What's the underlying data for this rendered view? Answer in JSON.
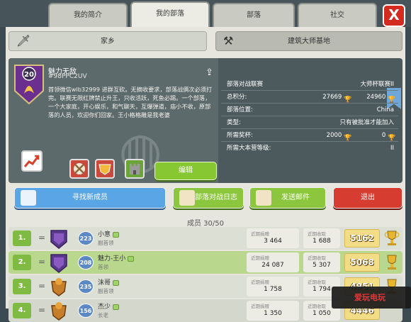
{
  "tabs": [
    {
      "label": "我的简介"
    },
    {
      "label": "我的部落"
    },
    {
      "label": "部落"
    },
    {
      "label": "社交"
    }
  ],
  "close_label": "X",
  "subtabs": {
    "home": "家乡",
    "builder_base": "建筑大师基地"
  },
  "clan": {
    "level": "20",
    "name": "魅力无敌",
    "tag": "#98PPC2UV",
    "description": "首领微信wlb32999 进群互砍。无摘收要求，部落战俩次必须打完。联赛无限红牌禁止升王，只收活跃，死鱼必踢。一个部落，一个大家庭，开心娱乐，和气聊天，互爆弹道，庙小不收，原部落的人员，欢迎你们回家。王小格格雕是我老婆",
    "edit_label": "编辑"
  },
  "stats": [
    {
      "key": "部落对战联赛",
      "value": "大师杯联赛II"
    },
    {
      "key": "总积分:",
      "value": "27669",
      "value2": "24960"
    },
    {
      "key": "部落位置:",
      "value": "China"
    },
    {
      "key": "类型:",
      "value": "只有被批准才能加入"
    },
    {
      "key": "所需奖杯:",
      "value": "2000",
      "value2": "0"
    },
    {
      "key": "所需大本营等级:",
      "value": "II"
    }
  ],
  "actions": {
    "find_members": "寻找新成员",
    "war_log": "部落对战日志",
    "send_mail": "发送邮件",
    "leave": "退出"
  },
  "members_title": "成员 30/50",
  "members": [
    {
      "rank": "1.",
      "level": "223",
      "name": "小意",
      "role": "副首领",
      "donated_label": "近期捐赠",
      "donated": "3 464",
      "received_label": "近期收取",
      "received": "1 688",
      "trophies": "5162"
    },
    {
      "rank": "2.",
      "level": "208",
      "name": "魅力-王小",
      "role": "首领",
      "donated_label": "近期捐赠",
      "donated": "24 087",
      "received_label": "近期收取",
      "received": "5 307",
      "trophies": "5068"
    },
    {
      "rank": "3.",
      "level": "235",
      "name": "沫哥",
      "role": "副首领",
      "donated_label": "近期捐赠",
      "donated": "1 758",
      "received_label": "近期收取",
      "received": "1 794",
      "trophies": "4951"
    },
    {
      "rank": "4.",
      "level": "156",
      "name": "杰少",
      "role": "长老",
      "donated_label": "近期捐赠",
      "donated": "1 350",
      "received_label": "近期收取",
      "received": "1 050",
      "trophies": "4446"
    }
  ],
  "watermark": "爱玩电玩",
  "colors": {
    "accent_green": "#86c732",
    "blue": "#5aa5e6",
    "red": "#d63c2f",
    "panel": "#e7e6de"
  }
}
